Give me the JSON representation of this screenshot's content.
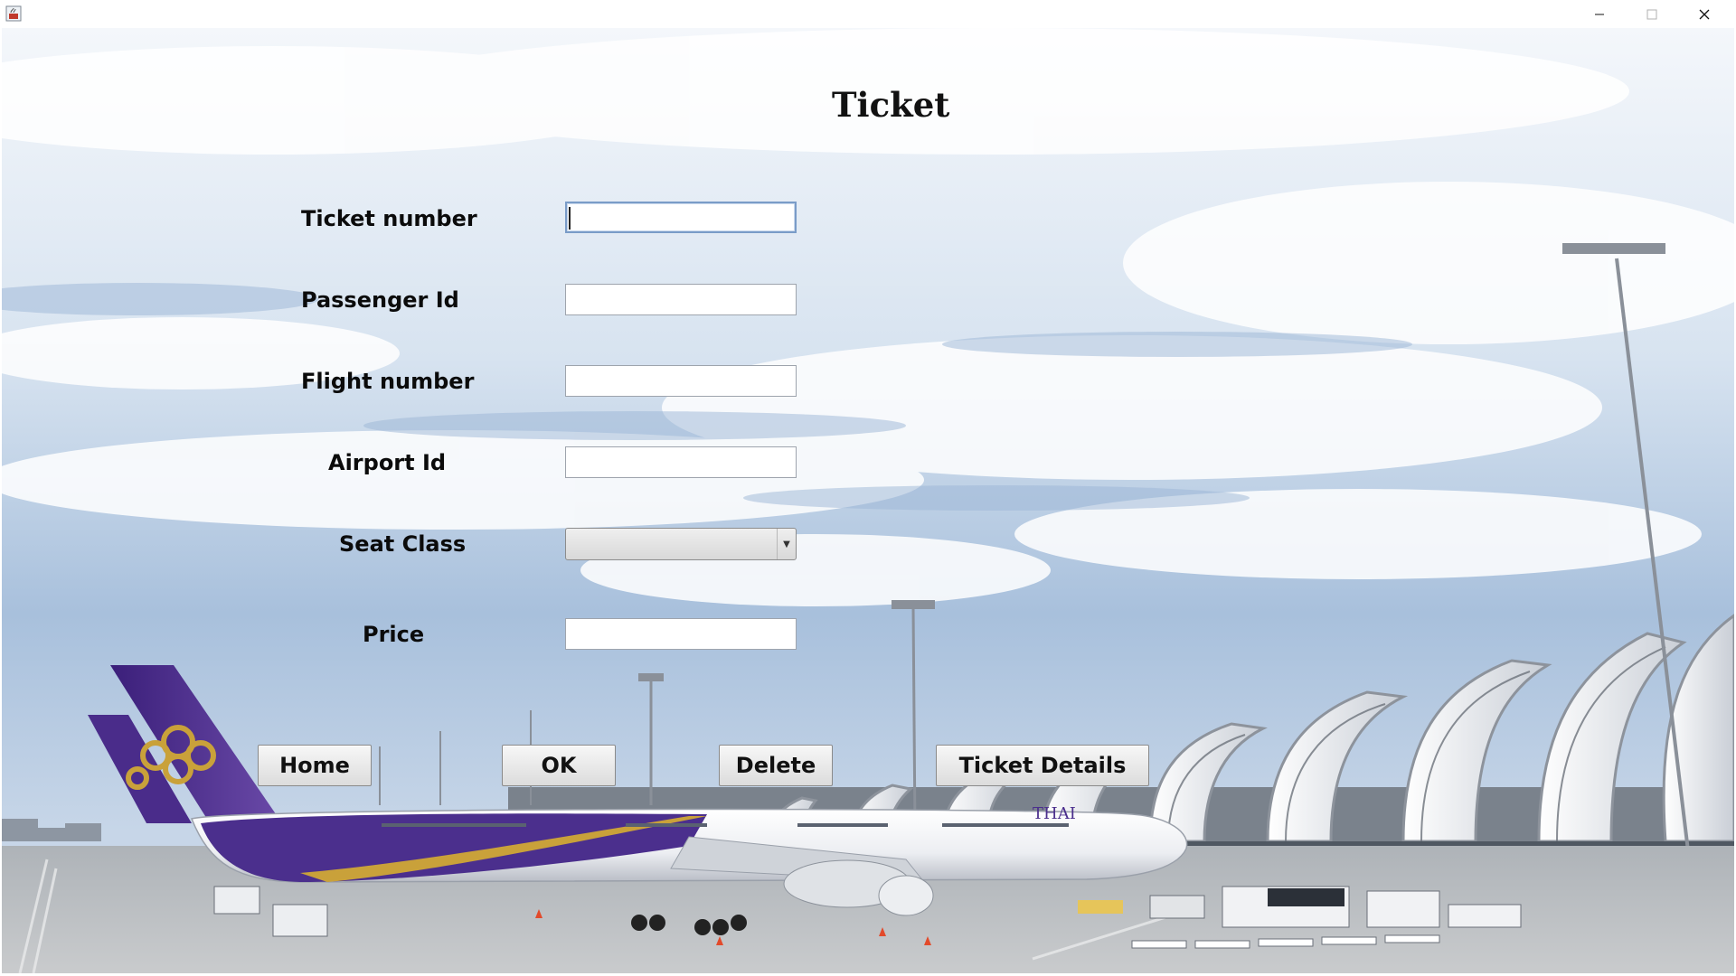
{
  "window": {
    "title": "",
    "controls": {
      "minimize_icon": "minimize-icon",
      "maximize_icon": "maximize-icon",
      "close_icon": "close-icon"
    }
  },
  "form": {
    "heading": "Ticket",
    "fields": [
      {
        "label": "Ticket number",
        "value": "",
        "focused": true
      },
      {
        "label": "Passenger Id",
        "value": ""
      },
      {
        "label": "Flight number",
        "value": ""
      },
      {
        "label": "Airport Id",
        "value": ""
      },
      {
        "label": "Seat Class",
        "value": "",
        "type": "dropdown"
      },
      {
        "label": "Price",
        "value": ""
      }
    ],
    "buttons": {
      "home": "Home",
      "ok": "OK",
      "delete": "Delete",
      "details": "Ticket Details"
    }
  },
  "background": {
    "airline_text": "THAI",
    "colors": {
      "sky_top": "#dbe6f2",
      "sky_mid": "#a9c1de",
      "tarmac": "#b9bcbf",
      "plane_purple": "#4b2f8d",
      "plane_gold": "#c9a13a"
    }
  }
}
